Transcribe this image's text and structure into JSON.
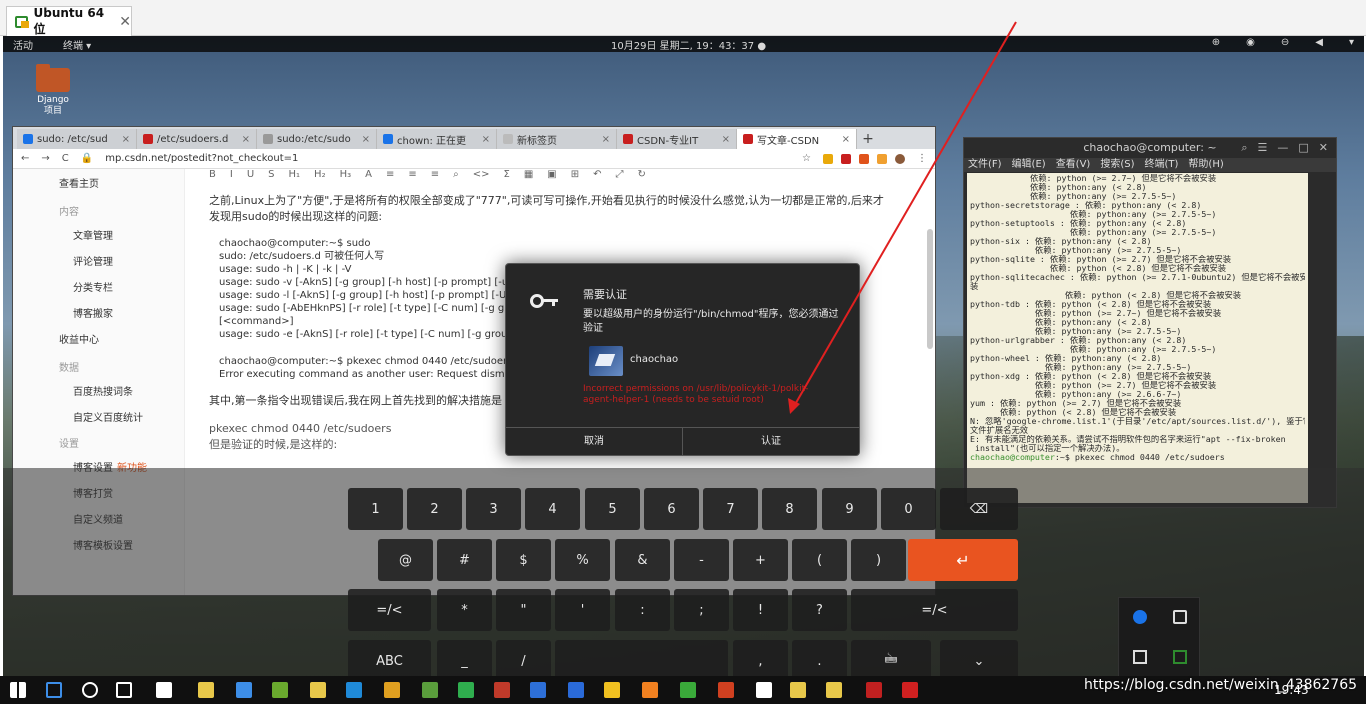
{
  "vm": {
    "tab_title": "Ubuntu 64 位",
    "close": "✕"
  },
  "ubuntu_topbar": {
    "activities": "活动",
    "app_menu": "终端 ▾",
    "clock": "10月29日 星期二, 19：43：37 ●",
    "tray": [
      "⊕",
      "◉",
      "⊖",
      "◀",
      "▾"
    ]
  },
  "desktop_icon": {
    "label": "Django\n项目"
  },
  "browser": {
    "tabs": [
      {
        "label": "sudo: /etc/sud",
        "color": "#1a73e8",
        "active": false
      },
      {
        "label": "/etc/sudoers.d",
        "color": "#c81f1f",
        "active": false
      },
      {
        "label": "sudo:/etc/sudo",
        "color": "#999999",
        "active": false
      },
      {
        "label": "chown: 正在更",
        "color": "#1a73e8",
        "active": false
      },
      {
        "label": "新标签页",
        "color": "#bbbbbb",
        "active": false
      },
      {
        "label": "CSDN-专业IT",
        "color": "#c81f1f",
        "active": false
      },
      {
        "label": "写文章-CSDN",
        "color": "#c81f1f",
        "active": true
      }
    ],
    "tab_close": "×",
    "new_tab": "+",
    "nav": {
      "back": "←",
      "forward": "→",
      "reload": "C",
      "lock": "🔒"
    },
    "url": "mp.csdn.net/postedit?not_checkout=1",
    "star": "☆",
    "menu": "⋮",
    "toolbar": [
      "B",
      "I",
      "U",
      "S",
      "H₁",
      "H₂",
      "H₃",
      "A",
      "≡",
      "≡",
      "≡",
      "⌕",
      "<>",
      "Σ",
      "▦",
      "▣",
      "⊞",
      "↶",
      "⤢",
      "↻"
    ],
    "sidebar": {
      "top": "查看主页",
      "sections": [
        {
          "title": "内容",
          "items": [
            "文章管理",
            "评论管理",
            "分类专栏",
            "博客搬家"
          ]
        },
        {
          "title": "收益中心",
          "items": []
        },
        {
          "title": "数据",
          "items": [
            "百度热搜词条",
            "自定义百度统计"
          ]
        },
        {
          "title": "设置",
          "items": [
            "博客设置",
            "博客打赏",
            "自定义频道",
            "博客模板设置"
          ]
        }
      ],
      "badge": "新功能"
    },
    "content": {
      "para1": "之前,Linux上为了\"方便\",于是将所有的权限全部变成了\"777\",可读可写可操作,开始看见执行的时候没什么感觉,认为一切都是正常的,后来才发现用sudo的时候出现这样的问题:",
      "code1": [
        "chaochao@computer:~$ sudo",
        "sudo: /etc/sudoers.d 可被任何人写",
        "usage: sudo -h | -K | -k | -V",
        "usage: sudo -v [-AknS] [-g group] [-h host] [-p prompt] [-u user]",
        "usage: sudo -l [-AknS] [-g group] [-h host] [-p prompt] [-U user]",
        "usage: sudo [-AbEHknPS] [-r role] [-t type] [-C num] [-g group] [-",
        "            [<command>]",
        "usage: sudo -e [-AknS] [-r role] [-t type] [-C num] [-g group] [-h h"
      ],
      "code2": [
        "chaochao@computer:~$ pkexec chmod 0440 /etc/sudoers",
        "Error executing command as another user: Request dismissed"
      ],
      "para2": "其中,第一条指令出现错误后,我在网上首先找到的解决措施是",
      "line3": "pkexec chmod 0440 /etc/sudoers",
      "line4": "但是验证的时候,是这样的:"
    }
  },
  "terminal": {
    "title": "chaochao@computer: ~",
    "controls": [
      "⌕",
      "☰",
      "—",
      "□",
      "✕"
    ],
    "menu": [
      "文件(F)",
      "编辑(E)",
      "查看(V)",
      "搜索(S)",
      "终端(T)",
      "帮助(H)"
    ],
    "lines": [
      "            依赖: python (>= 2.7~) 但是它将不会被安装",
      "            依赖: python:any (< 2.8)",
      "            依赖: python:any (>= 2.7.5-5~)",
      "python-secretstorage : 依赖: python:any (< 2.8)",
      "                    依赖: python:any (>= 2.7.5-5~)",
      "python-setuptools : 依赖: python:any (< 2.8)",
      "                    依赖: python:any (>= 2.7.5-5~)",
      "python-six : 依赖: python:any (< 2.8)",
      "             依赖: python:any (>= 2.7.5-5~)",
      "python-sqlite : 依赖: python (>= 2.7) 但是它将不会被安装",
      "                依赖: python (< 2.8) 但是它将不会被安装",
      "python-sqlitecachec : 依赖: python (>= 2.7.1-0ubuntu2) 但是它将不会被安",
      "装",
      "                   依赖: python (< 2.8) 但是它将不会被安装",
      "python-tdb : 依赖: python (< 2.8) 但是它将不会被安装",
      "             依赖: python (>= 2.7~) 但是它将不会被安装",
      "             依赖: python:any (< 2.8)",
      "             依赖: python:any (>= 2.7.5-5~)",
      "python-urlgrabber : 依赖: python:any (< 2.8)",
      "                    依赖: python:any (>= 2.7.5-5~)",
      "python-wheel : 依赖: python:any (< 2.8)",
      "               依赖: python:any (>= 2.7.5-5~)",
      "python-xdg : 依赖: python (< 2.8) 但是它将不会被安装",
      "             依赖: python (>= 2.7) 但是它将不会被安装",
      "             依赖: python:any (>= 2.6.6-7~)",
      "yum : 依赖: python (>= 2.7) 但是它将不会被安装",
      "      依赖: python (< 2.8) 但是它将不会被安装",
      "N: 忽略'google-chrome.list.1'(于目录'/etc/apt/sources.list.d/'), 鉴于它的",
      "文件扩展名无效",
      "E: 有未能满足的依赖关系。请尝试不指明软件包的名字来运行\"apt --fix-broken",
      " install\"(也可以指定一个解决办法)。"
    ],
    "prompt_user": "chaochao@computer",
    "prompt_cmd": ":~$ pkexec chmod 0440 /etc/sudoers"
  },
  "auth_dialog": {
    "title": "需要认证",
    "message": "要以超级用户的身份运行\"/bin/chmod\"程序，您必须通过验证",
    "user": "chaochao",
    "error": "Incorrect permissions on /usr/lib/policykit-1/polkit-agent-helper-1 (needs to be setuid root)",
    "cancel": "取消",
    "confirm": "认证"
  },
  "keyboard": {
    "row1": [
      "1",
      "2",
      "3",
      "4",
      "5",
      "6",
      "7",
      "8",
      "9",
      "0",
      "⌫"
    ],
    "row2": [
      "@",
      "#",
      "$",
      "%",
      "&",
      "-",
      "+",
      "(",
      ")",
      "↵"
    ],
    "row3": [
      "=/<",
      "*",
      "\"",
      "'",
      ":",
      ";",
      "!",
      "?",
      "=/<"
    ],
    "row4": [
      "ABC",
      "_",
      "/",
      ",",
      ".",
      "🖮",
      "⌄"
    ]
  },
  "taskbar": {
    "watermark": "https://blog.csdn.net/weixin_43862765",
    "time": "19:43",
    "icons": [
      "#3d8ee8",
      "#ffffff",
      "#ffffff",
      "#ffffff",
      "#e8c84a",
      "#3d8ee8",
      "#6aaa2e",
      "#e8c84a",
      "#1f8ad8",
      "#e0a020",
      "#5a9e3c",
      "#2fae4e",
      "#c03a2a",
      "#2d6fd8",
      "#2a6ad8",
      "#f0c020",
      "#f08020",
      "#3aaa3a",
      "#d04020",
      "#ffffff",
      "#e8c84a",
      "#e8c84a",
      "#c02020",
      "#d02020"
    ]
  },
  "colors": {
    "accent": "#e95420",
    "error": "#c81f1f",
    "arrow": "#e02020"
  }
}
